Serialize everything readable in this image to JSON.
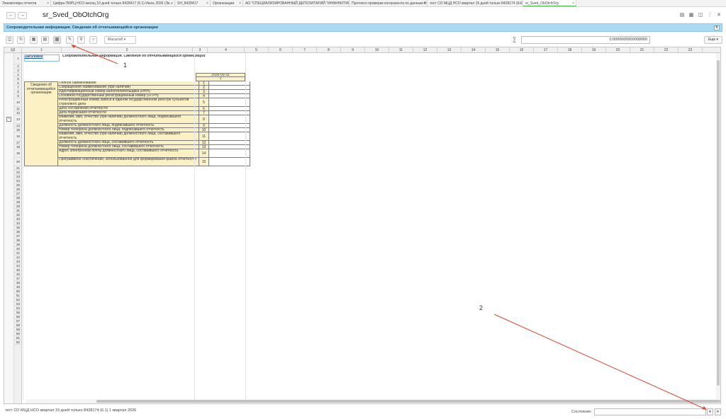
{
  "tabs": [
    {
      "label": "Экземпляры отчетов"
    },
    {
      "label": "Цифра ПИРЦ НСО месяц 10 дней только 8428417 (6.1) Июль 2026 (Эк..."
    },
    {
      "label": "SH_8428417"
    },
    {
      "label": "Организации"
    },
    {
      "label": "АО \"СПЕЦИАЛИЗИРОВАННЫЙ ДЕПОЗИТАРИЙ \"ИНФИНИТУМ\" (Д НС..."
    },
    {
      "label": "Протокол проверки контрагента по данным ФНС"
    },
    {
      "label": "тест СО МЦД НСО квартал 15 дней только 8428174 (6.1) 1 квартал 2026..."
    },
    {
      "label": "sr_Sved_ObOtchOrg"
    }
  ],
  "title": "sr_Sved_ObOtchOrg",
  "banner": "Сопроводительная информация. Сведения об отчитывающейся организации",
  "toolbar": {
    "scale_label": "Масштаб",
    "sum_value": "0.0000000000000000",
    "right_btn": "Еще"
  },
  "columns": [
    "1",
    "2",
    "3",
    "4",
    "5",
    "6",
    "7",
    "8",
    "9",
    "10",
    "11",
    "12",
    "13",
    "14",
    "15",
    "16",
    "17",
    "18",
    "19",
    "20",
    "21",
    "22",
    "23"
  ],
  "sheet": {
    "header_link": "Заголовок",
    "header_text": "Сопроводительная информация. Сведения об отчитывающейся организации",
    "date_value": "2026-03-31",
    "date_col": "1",
    "group_label": "Сведения об отчитывающейся организации",
    "rows": [
      {
        "label": "Полное наименование",
        "code": "1"
      },
      {
        "label": "Сокращенное наименование (при наличии)",
        "code": "2"
      },
      {
        "label": "Идентификационный номер налогоплательщика (ИНН)",
        "code": "3"
      },
      {
        "label": "Основной государственный регистрационный номер (ОГРН)",
        "code": "4"
      },
      {
        "label": "Регистрационный номер записи в едином государственном реестре субъектов страхового дела",
        "code": "5"
      },
      {
        "label": "Дата составления отчетности",
        "code": "6"
      },
      {
        "label": "Дата подписания отчетности",
        "code": "7"
      },
      {
        "label": "Фамилия, имя, отчество (при наличии) должностного лица, подписавшего отчетность",
        "code": "8"
      },
      {
        "label": "Должность должностного лица, подписавшего отчетность",
        "code": "9"
      },
      {
        "label": "Номер телефона должностного лица, подписавшего отчетность",
        "code": "10"
      },
      {
        "label": "Фамилия, имя, отчество (при наличии) должностного лица, составившего отчетность",
        "code": "11"
      },
      {
        "label": "Должность должностного лица, составившего отчетность",
        "code": "12"
      },
      {
        "label": "Номер телефона должностного лица, составившего отчетность",
        "code": "13"
      },
      {
        "label": "Адрес электронной почты должностного лица, составившего отчетность",
        "code": "14"
      },
      {
        "label": "Программное обеспечение, использованное для формирования файла отчетности",
        "code": "15"
      }
    ]
  },
  "footer": {
    "text": "тест СО МЦД НСО квартал 15 дней только 8428174 (6.1) 1 квартал 2026",
    "state_label": "Состояние:"
  },
  "annotations": [
    "1",
    "2"
  ]
}
